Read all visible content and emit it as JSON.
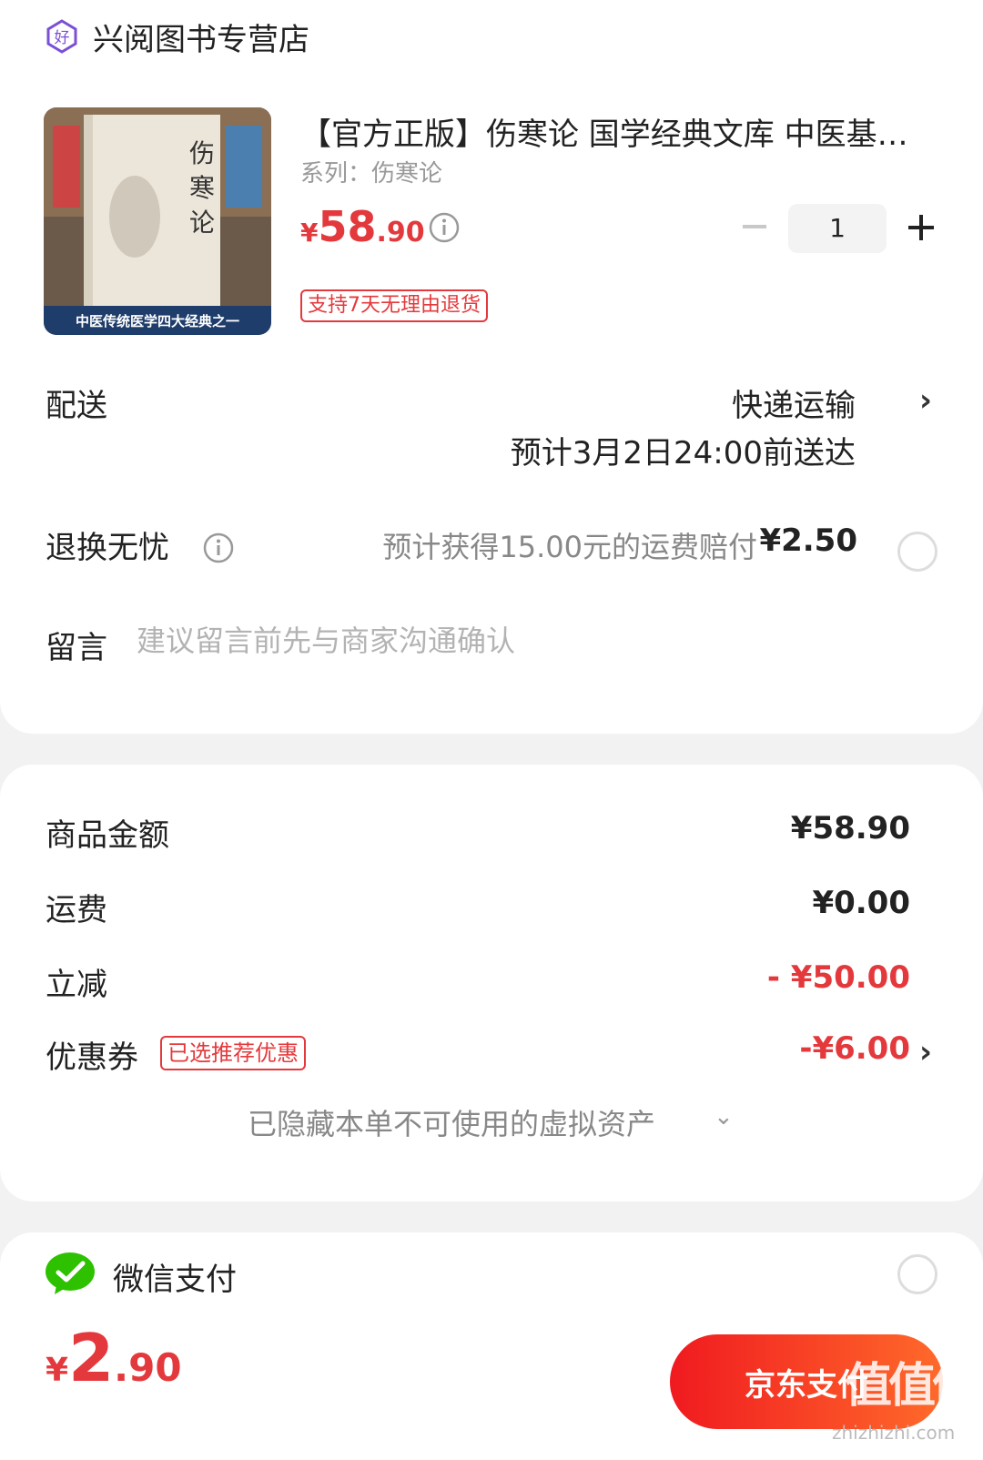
{
  "shop": {
    "name": "兴阅图书专营店",
    "icon": "shop-badge-icon",
    "icon_char": "好"
  },
  "product": {
    "cover_banner": "中医传统医学四大经典之一",
    "cover_title": "伤寒论",
    "title": "【官方正版】伤寒论 国学经典文库 中医基…",
    "series": "系列：伤寒论",
    "price": {
      "currency": "¥",
      "integer": "58",
      "decimal": ".90"
    },
    "quantity": "1",
    "return_tag": "支持7天无理由退货"
  },
  "delivery": {
    "label": "配送",
    "method": "快递运输",
    "eta": "预计3月2日24:00前送达"
  },
  "return_worry_free": {
    "label": "退换无忧",
    "description": "预计获得15.00元的运费赔付",
    "price": "¥2.50"
  },
  "message": {
    "label": "留言",
    "placeholder": "建议留言前先与商家沟通确认"
  },
  "summary": {
    "goods_amount": {
      "label": "商品金额",
      "value": "¥58.90"
    },
    "shipping": {
      "label": "运费",
      "value": "¥0.00"
    },
    "discount": {
      "label": "立减",
      "value": "- ¥50.00"
    },
    "coupon": {
      "label": "优惠券",
      "tag": "已选推荐优惠",
      "value": "-¥6.00"
    },
    "hidden_assets": "已隐藏本单不可使用的虚拟资产"
  },
  "payment": {
    "wechat_label": "微信支付"
  },
  "footer": {
    "total": {
      "currency": "¥",
      "integer": "2",
      "decimal": ".90"
    },
    "pay_button": "京东支付",
    "watermark": "值值值",
    "watermark_site": "zhizhizhi.com"
  },
  "colors": {
    "accent": "#e4393c",
    "button_start": "#f01a20",
    "button_end": "#ff6a2a",
    "wechat": "#2dc100"
  }
}
